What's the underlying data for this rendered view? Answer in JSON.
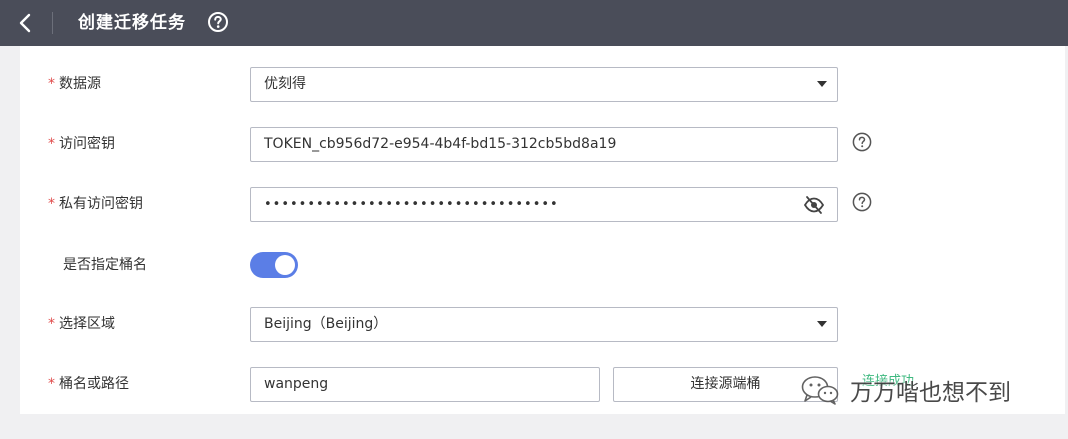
{
  "header": {
    "title": "创建迁移任务"
  },
  "form": {
    "source": {
      "label": "数据源",
      "value": "优刻得"
    },
    "access_key": {
      "label": "访问密钥",
      "value": "TOKEN_cb956d72-e954-4b4f-bd15-312cb5bd8a19"
    },
    "secret_key": {
      "label": "私有访问密钥",
      "value": "••••••••••••••••••••••••••••••••••"
    },
    "specify_bucket": {
      "label": "是否指定桶名",
      "enabled": true
    },
    "region": {
      "label": "选择区域",
      "value": "Beijing（Beijing）"
    },
    "bucket": {
      "label": "桶名或路径",
      "value": "wanpeng",
      "connect_label": "连接源端桶",
      "status": "连接成功"
    }
  },
  "watermark": {
    "text": "万万喈也想不到"
  },
  "colors": {
    "header_bg": "#4a4d59",
    "toggle_on": "#5b7ee6",
    "required": "#e04a4a",
    "success": "#3fb980"
  }
}
